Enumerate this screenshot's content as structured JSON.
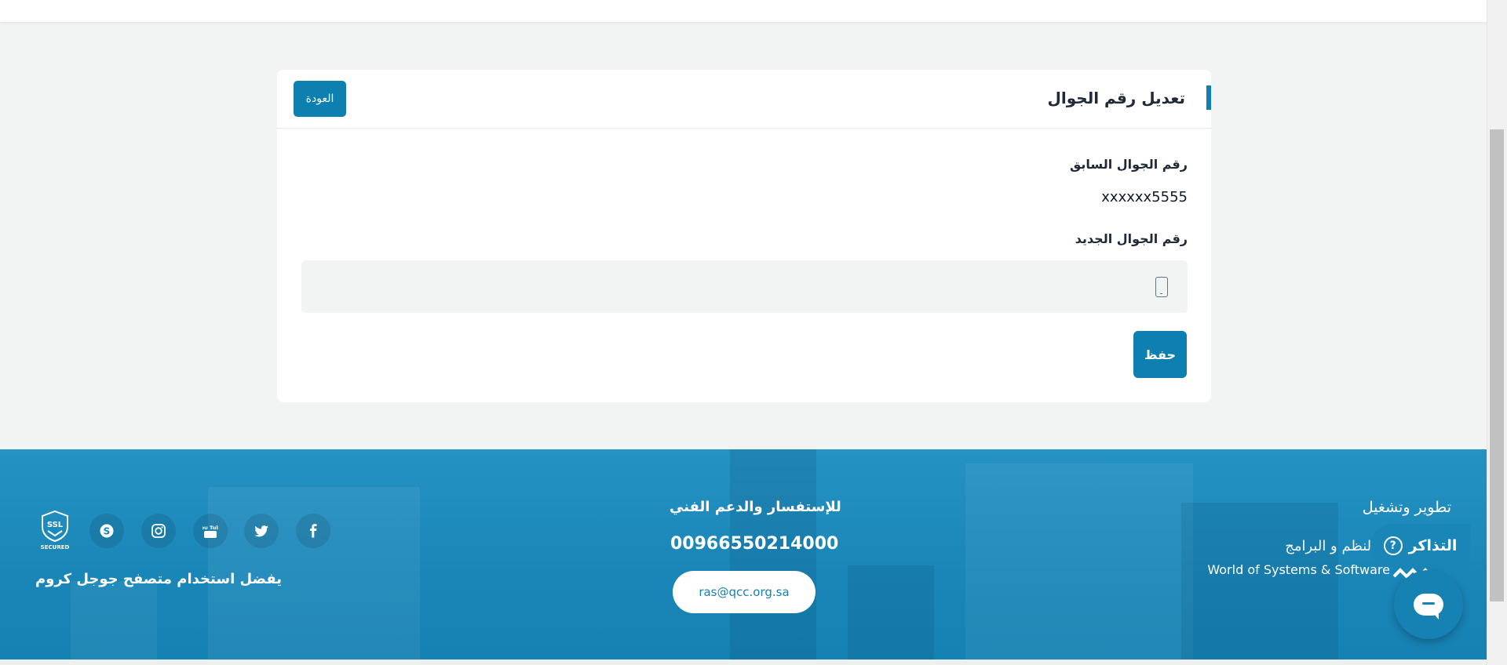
{
  "page": {
    "card_title": "تعديل رقم الجوال",
    "back_label": "العودة",
    "old_label": "رقم الجوال السابق",
    "old_value": "xxxxxx5555",
    "new_label": "رقم الجوال الجديد",
    "new_value": "",
    "save_label": "حفظ"
  },
  "footer": {
    "dev_title": "تطوير وتشغيل",
    "company_ar": "م النظم و البرامج",
    "company_en": "World of Systems & Software",
    "contact_title": "للإستفسار والدعم الفني",
    "contact_phone": "00966550214000",
    "contact_email": "ras@qcc.org.sa",
    "chrome_note": "يفضل استخدام متصفح جوجل كروم",
    "ssl_top": "SSL",
    "ssl_bottom": "SECURED",
    "social_icons": [
      "facebook-icon",
      "twitter-icon",
      "youtube-icon",
      "instagram-icon",
      "skype-icon"
    ],
    "youtube_text": "You Tube"
  },
  "widgets": {
    "tickets_label": "التذاكر",
    "tickets_icon": "?"
  },
  "colors": {
    "accent": "#0e7fb1",
    "footer_bg": "#1a86b8"
  }
}
